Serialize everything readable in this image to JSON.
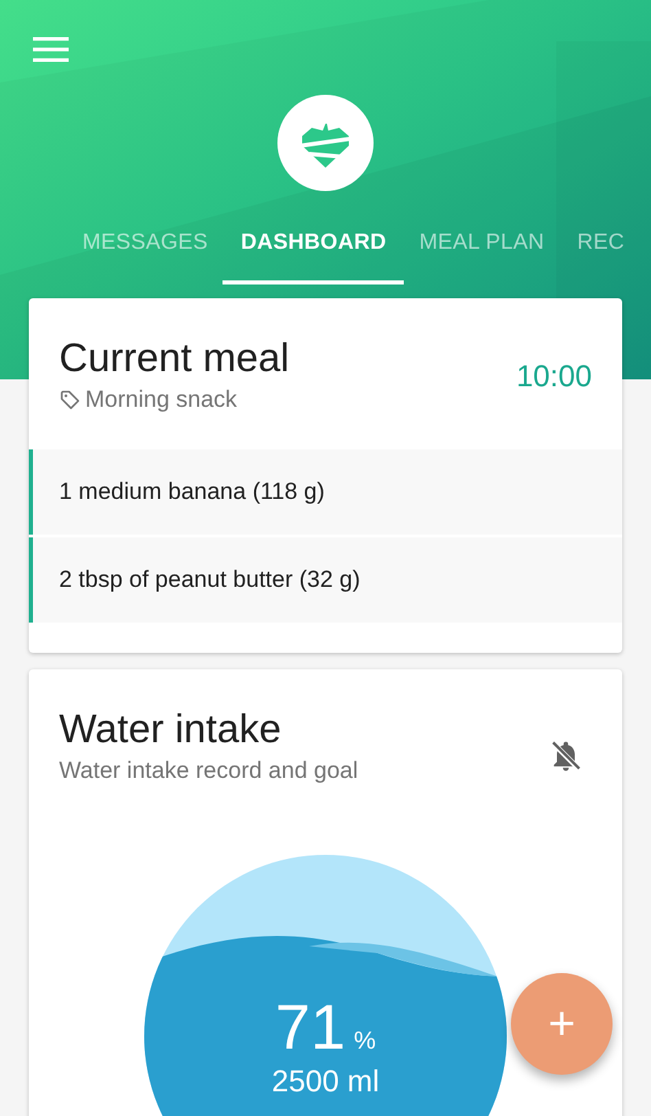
{
  "tabs": [
    {
      "label": "MESSAGES",
      "selected": false
    },
    {
      "label": "DASHBOARD",
      "selected": true
    },
    {
      "label": "MEAL PLAN",
      "selected": false
    },
    {
      "label": "REC",
      "selected": false
    }
  ],
  "current_meal": {
    "title": "Current meal",
    "tag": "Morning snack",
    "time": "10:00",
    "items": [
      "1 medium banana (118 g)",
      "2 tbsp of peanut butter (32 g)"
    ]
  },
  "water_intake": {
    "title": "Water intake",
    "subtitle": "Water intake record and goal",
    "notifications_muted": true,
    "percent": "71",
    "percent_unit": "%",
    "amount": "2500 ml"
  },
  "fab": {
    "label": "+"
  }
}
